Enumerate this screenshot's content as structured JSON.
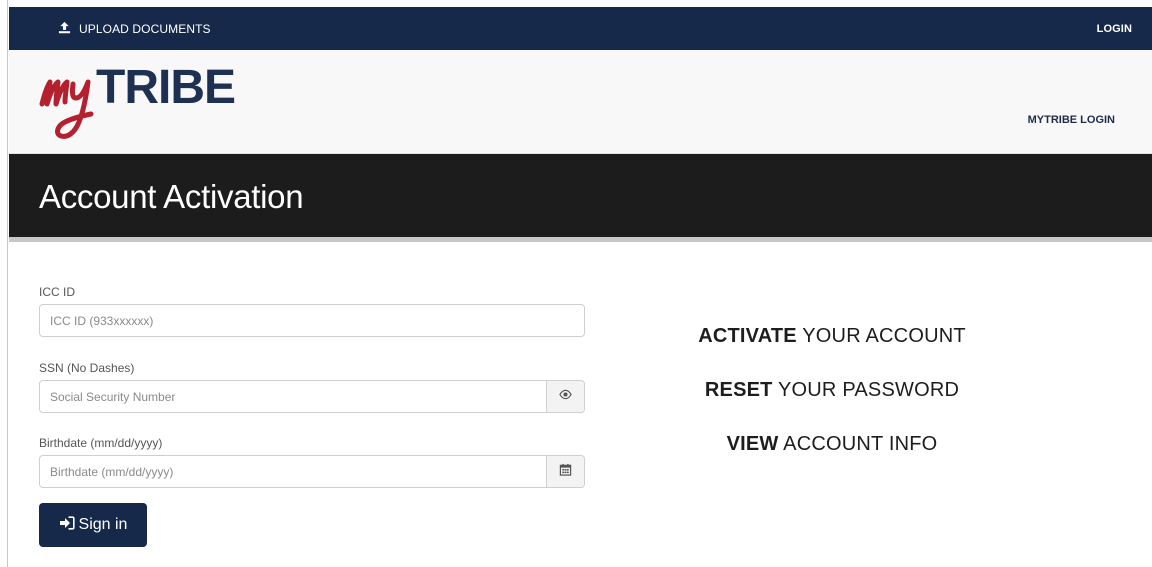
{
  "topbar": {
    "upload_label": "UPLOAD DOCUMENTS",
    "upload_icon": "upload-icon",
    "login_label": "LOGIN"
  },
  "header": {
    "logo_script": "my",
    "logo_text": "TRIBE",
    "mytribe_login_label": "MYTRIBE LOGIN"
  },
  "page": {
    "title": "Account Activation"
  },
  "form": {
    "icc": {
      "label": "ICC ID",
      "placeholder": "ICC ID (933xxxxxx)",
      "value": ""
    },
    "ssn": {
      "label": "SSN (No Dashes)",
      "placeholder": "Social Security Number",
      "value": "",
      "addon_icon": "eye-icon"
    },
    "birthdate": {
      "label": "Birthdate (mm/dd/yyyy)",
      "placeholder": "Birthdate (mm/dd/yyyy)",
      "value": "",
      "addon_icon": "calendar-icon"
    },
    "signin_label": "Sign in",
    "signin_icon": "sign-in-icon"
  },
  "promo": [
    {
      "bold": "ACTIVATE",
      "rest": " YOUR ACCOUNT"
    },
    {
      "bold": "RESET",
      "rest": " YOUR PASSWORD"
    },
    {
      "bold": "VIEW",
      "rest": " ACCOUNT INFO"
    }
  ],
  "colors": {
    "navy": "#16294b",
    "title_band": "#1c1c1c",
    "logo_red": "#b5202e",
    "logo_navy": "#1f3152"
  }
}
